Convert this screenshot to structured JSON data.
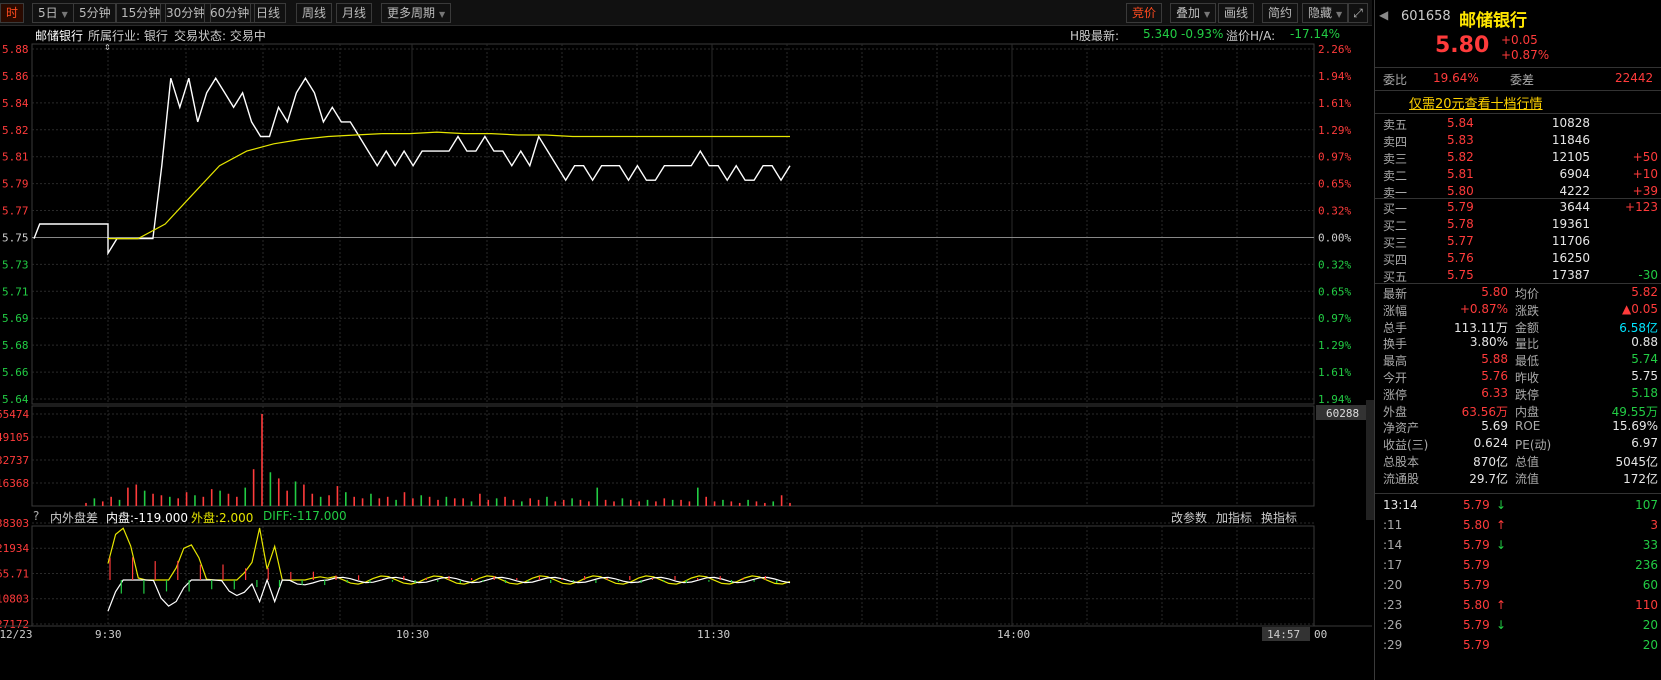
{
  "toolbar": {
    "buttons": [
      "时",
      "5日",
      "5分钟",
      "15分钟",
      "30分钟",
      "60分钟",
      "日线",
      "周线",
      "月线",
      "更多周期"
    ],
    "right_buttons": [
      "竞价",
      "叠加",
      "画线",
      "简约",
      "隐藏"
    ],
    "expand_icon": "expand-icon"
  },
  "header": {
    "stock_name": "邮储银行",
    "industry": "所属行业: 银行",
    "status": "交易状态: 交易中",
    "h_label": "H股最新:",
    "h_price": "5.340",
    "h_change": "-0.93%",
    "premium_label": "溢价H/A:",
    "premium_value": "-17.14%",
    "h_tag": "H股"
  },
  "chart_data": {
    "type": "line",
    "price_axis": [
      "5.88",
      "5.86",
      "5.84",
      "5.82",
      "5.81",
      "5.79",
      "5.77",
      "5.75",
      "5.73",
      "5.71",
      "5.69",
      "5.68",
      "5.66",
      "5.64"
    ],
    "pct_axis": [
      "2.26%",
      "1.94%",
      "1.61%",
      "1.29%",
      "0.97%",
      "0.65%",
      "0.32%",
      "0.00%",
      "0.32%",
      "0.65%",
      "0.97%",
      "1.29%",
      "1.61%",
      "1.94%"
    ],
    "prev_close": 5.75,
    "ylim": [
      5.62,
      5.88
    ],
    "volume_axis": [
      "65474",
      "49105",
      "32737",
      "16368"
    ],
    "volume_marker": "60288",
    "x_labels": [
      "12/23",
      "9:30",
      "10:30",
      "11:30",
      "14:00",
      "14:57",
      "00"
    ],
    "series": [
      {
        "color": "#ffffff",
        "values": [
          5.75,
          5.76,
          5.76,
          5.76,
          5.76,
          5.76,
          5.76,
          5.76,
          5.76,
          5.76,
          5.76,
          5.76,
          5.76,
          5.76,
          5.74,
          5.75,
          5.75,
          5.75,
          5.75,
          5.75,
          5.8,
          5.86,
          5.84,
          5.86,
          5.83,
          5.85,
          5.86,
          5.85,
          5.84,
          5.85,
          5.83,
          5.82,
          5.82,
          5.84,
          5.83,
          5.85,
          5.86,
          5.85,
          5.83,
          5.84,
          5.83,
          5.83,
          5.82,
          5.81,
          5.8,
          5.81,
          5.8,
          5.81,
          5.8,
          5.81,
          5.81,
          5.81,
          5.81,
          5.82,
          5.81,
          5.81,
          5.82,
          5.81,
          5.81,
          5.8,
          5.81,
          5.8,
          5.82,
          5.81,
          5.8,
          5.79,
          5.8,
          5.8,
          5.79,
          5.8,
          5.8,
          5.8,
          5.79,
          5.8,
          5.79,
          5.79,
          5.8,
          5.8,
          5.8,
          5.8,
          5.81,
          5.8,
          5.8,
          5.79,
          5.8,
          5.79,
          5.79,
          5.8,
          5.8,
          5.79,
          5.8
        ]
      },
      {
        "color": "#e6e600",
        "values": [
          5.75,
          5.75,
          5.75,
          5.76,
          5.78,
          5.8,
          5.81,
          5.815,
          5.818,
          5.82,
          5.821,
          5.822,
          5.822,
          5.823,
          5.822,
          5.822,
          5.821,
          5.821,
          5.82,
          5.82,
          5.82,
          5.82,
          5.82,
          5.82,
          5.82,
          5.82,
          5.82
        ]
      }
    ],
    "volume": [
      2,
      5,
      3,
      6,
      4,
      12,
      14,
      10,
      8,
      7,
      6,
      5,
      9,
      7,
      6,
      11,
      10,
      8,
      6,
      12,
      24,
      60,
      22,
      18,
      10,
      16,
      14,
      8,
      6,
      7,
      13,
      9,
      6,
      5,
      8,
      5,
      6,
      4,
      9,
      5,
      7,
      6,
      4,
      6,
      5,
      5,
      3,
      8,
      4,
      5,
      6,
      4,
      3,
      5,
      4,
      6,
      3,
      4,
      5,
      4,
      3,
      12,
      4,
      3,
      5,
      4,
      3,
      4,
      3,
      5,
      4,
      4,
      3,
      12,
      6,
      3,
      4,
      3,
      2,
      4,
      3,
      2,
      3,
      7,
      2
    ],
    "volume_ylim": [
      0,
      65474
    ]
  },
  "indicator": {
    "name": "内外盘差",
    "inner_label": "内盘:-119.000",
    "outer_label": "外盘:2.000",
    "diff_label": "DIFF:-117.000",
    "axis": [
      "38303",
      "21934",
      "65.71",
      "10803",
      "27172"
    ],
    "actions": [
      "改参数",
      "加指标",
      "换指标"
    ]
  },
  "sidebar": {
    "code": "601658",
    "name": "邮储银行",
    "price": "5.80",
    "change": "+0.05",
    "change_pct": "+0.87%",
    "weibi_label": "委比",
    "weibi_value": "19.64%",
    "weicha_label": "委差",
    "weicha_value": "22442",
    "promo": "仅需20元查看十档行情",
    "asks": [
      {
        "label": "卖五",
        "price": "5.84",
        "vol": "10828",
        "delta": ""
      },
      {
        "label": "卖四",
        "price": "5.83",
        "vol": "11846",
        "delta": ""
      },
      {
        "label": "卖三",
        "price": "5.82",
        "vol": "12105",
        "delta": "+50"
      },
      {
        "label": "卖二",
        "price": "5.81",
        "vol": "6904",
        "delta": "+10"
      },
      {
        "label": "卖一",
        "price": "5.80",
        "vol": "4222",
        "delta": "+39"
      }
    ],
    "bids": [
      {
        "label": "买一",
        "price": "5.79",
        "vol": "3644",
        "delta": "+123"
      },
      {
        "label": "买二",
        "price": "5.78",
        "vol": "19361",
        "delta": ""
      },
      {
        "label": "买三",
        "price": "5.77",
        "vol": "11706",
        "delta": ""
      },
      {
        "label": "买四",
        "price": "5.76",
        "vol": "16250",
        "delta": ""
      },
      {
        "label": "买五",
        "price": "5.75",
        "vol": "17387",
        "delta": "-30"
      }
    ],
    "stats": [
      {
        "l1": "最新",
        "v1": "5.80",
        "c1": "red",
        "l2": "均价",
        "v2": "5.82",
        "c2": "red"
      },
      {
        "l1": "涨幅",
        "v1": "+0.87%",
        "c1": "red",
        "l2": "涨跌",
        "v2": "▲0.05",
        "c2": "red"
      },
      {
        "l1": "总手",
        "v1": "113.11万",
        "c1": "white",
        "l2": "金额",
        "v2": "6.58亿",
        "c2": "cyan"
      },
      {
        "l1": "换手",
        "v1": "3.80%",
        "c1": "white",
        "l2": "量比",
        "v2": "0.88",
        "c2": "white"
      },
      {
        "l1": "最高",
        "v1": "5.88",
        "c1": "red",
        "l2": "最低",
        "v2": "5.74",
        "c2": "green"
      },
      {
        "l1": "今开",
        "v1": "5.76",
        "c1": "red",
        "l2": "昨收",
        "v2": "5.75",
        "c2": "white"
      },
      {
        "l1": "涨停",
        "v1": "6.33",
        "c1": "red",
        "l2": "跌停",
        "v2": "5.18",
        "c2": "green"
      },
      {
        "l1": "外盘",
        "v1": "63.56万",
        "c1": "red",
        "l2": "内盘",
        "v2": "49.55万",
        "c2": "green"
      },
      {
        "l1": "净资产",
        "v1": "5.69",
        "c1": "white",
        "l2": "ROE",
        "v2": "15.69%",
        "c2": "white"
      },
      {
        "l1": "收益(三)",
        "v1": "0.624",
        "c1": "white",
        "l2": "PE(动)",
        "v2": "6.97",
        "c2": "white"
      },
      {
        "l1": "总股本",
        "v1": "870亿",
        "c1": "white",
        "l2": "总值",
        "v2": "5045亿",
        "c2": "white"
      },
      {
        "l1": "流通股",
        "v1": "29.7亿",
        "c1": "white",
        "l2": "流值",
        "v2": "172亿",
        "c2": "white"
      }
    ],
    "ticks": [
      {
        "time": "13:14",
        "price": "5.79",
        "dir": "↓",
        "vol": "107",
        "vc": "green"
      },
      {
        "time": ":11",
        "price": "5.80",
        "dir": "↑",
        "vol": "3",
        "vc": "red"
      },
      {
        "time": ":14",
        "price": "5.79",
        "dir": "↓",
        "vol": "33",
        "vc": "green"
      },
      {
        "time": ":17",
        "price": "5.79",
        "dir": "",
        "vol": "236",
        "vc": "green"
      },
      {
        "time": ":20",
        "price": "5.79",
        "dir": "",
        "vol": "60",
        "vc": "green"
      },
      {
        "time": ":23",
        "price": "5.80",
        "dir": "↑",
        "vol": "110",
        "vc": "red"
      },
      {
        "time": ":26",
        "price": "5.79",
        "dir": "↓",
        "vol": "20",
        "vc": "green"
      },
      {
        "time": ":29",
        "price": "5.79",
        "dir": "",
        "vol": "20",
        "vc": "green"
      }
    ]
  },
  "colors": {
    "up": "#ff3b3b",
    "down": "#22cc44",
    "avg": "#e6e600",
    "price": "#ffffff",
    "grid": "#2a2a2a"
  }
}
